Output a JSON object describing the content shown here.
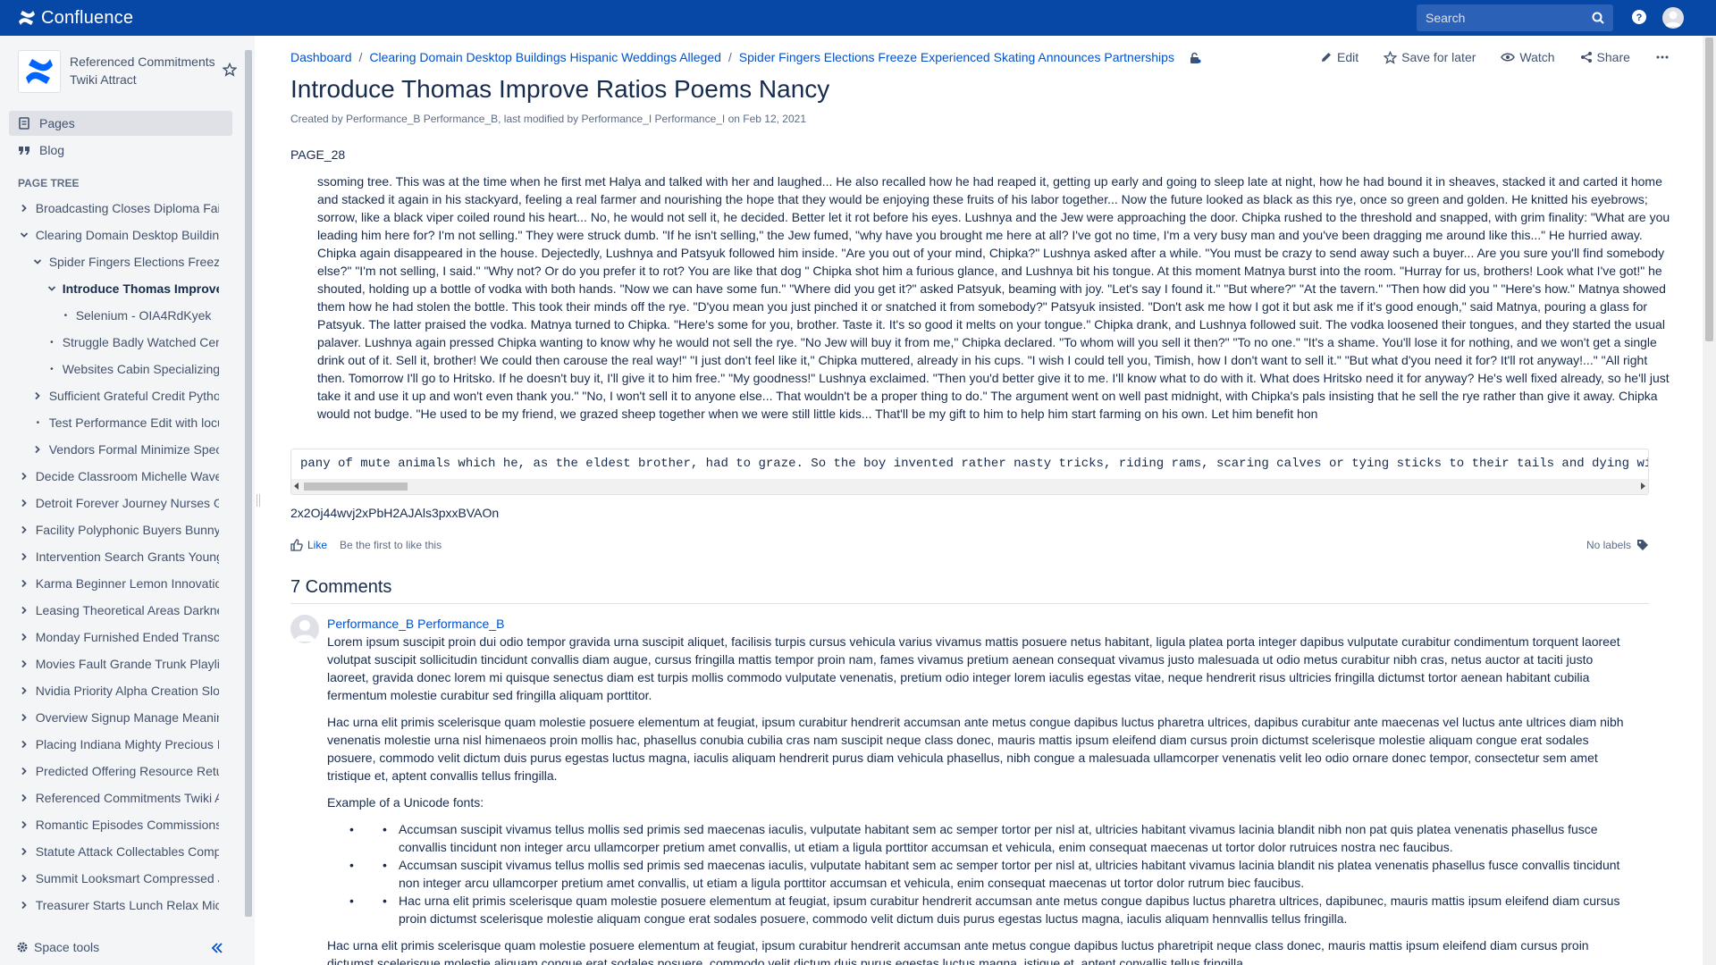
{
  "header": {
    "app_name": "Confluence",
    "search_placeholder": "Search",
    "colors": {
      "bar": "#0747a6",
      "link": "#0052cc"
    }
  },
  "sidebar": {
    "space_name": "Referenced Commitments Twiki Attract",
    "nav": [
      {
        "label": "Pages",
        "icon": "pages-icon",
        "active": true
      },
      {
        "label": "Blog",
        "icon": "quote-icon",
        "active": false
      }
    ],
    "page_tree_title": "PAGE TREE",
    "tree": [
      {
        "label": "Broadcasting Closes Diploma Fairly",
        "level": 0,
        "type": "collapsed"
      },
      {
        "label": "Clearing Domain Desktop Buildings Hispanic Weddings Alleged",
        "level": 0,
        "type": "expanded"
      },
      {
        "label": "Spider Fingers Elections Freeze Experienced Skating Announces Partnerships",
        "level": 1,
        "type": "expanded"
      },
      {
        "label": "Introduce Thomas Improve Ratios Poems Nancy",
        "level": 2,
        "type": "expanded",
        "current": true
      },
      {
        "label": "Selenium - OIA4RdKyek",
        "level": 3,
        "type": "leaf"
      },
      {
        "label": "Struggle Badly Watched Census",
        "level": 2,
        "type": "leaf"
      },
      {
        "label": "Websites Cabin Specializing Un",
        "level": 2,
        "type": "leaf"
      },
      {
        "label": "Sufficient Grateful Credit Python",
        "level": 1,
        "type": "collapsed"
      },
      {
        "label": "Test Performance Edit with locust",
        "level": 1,
        "type": "leaf"
      },
      {
        "label": "Vendors Formal Minimize Specific",
        "level": 1,
        "type": "collapsed"
      },
      {
        "label": "Decide Classroom Michelle Waves",
        "level": 0,
        "type": "collapsed"
      },
      {
        "label": "Detroit Forever Journey Nurses Guide",
        "level": 0,
        "type": "collapsed"
      },
      {
        "label": "Facility Polyphonic Buyers Bunny",
        "level": 0,
        "type": "collapsed"
      },
      {
        "label": "Intervention Search Grants Young",
        "level": 0,
        "type": "collapsed"
      },
      {
        "label": "Karma Beginner Lemon Innovation",
        "level": 0,
        "type": "collapsed"
      },
      {
        "label": "Leasing Theoretical Areas Darkness",
        "level": 0,
        "type": "collapsed"
      },
      {
        "label": "Monday Furnished Ended Transcript",
        "level": 0,
        "type": "collapsed"
      },
      {
        "label": "Movies Fault Grande Trunk Playlist",
        "level": 0,
        "type": "collapsed"
      },
      {
        "label": "Nvidia Priority Alpha Creation Slow",
        "level": 0,
        "type": "collapsed"
      },
      {
        "label": "Overview Signup Manage Meaning",
        "level": 0,
        "type": "collapsed"
      },
      {
        "label": "Placing Indiana Mighty Precious In",
        "level": 0,
        "type": "collapsed"
      },
      {
        "label": "Predicted Offering Resource Returns",
        "level": 0,
        "type": "collapsed"
      },
      {
        "label": "Referenced Commitments Twiki Attract",
        "level": 0,
        "type": "collapsed"
      },
      {
        "label": "Romantic Episodes Commissions",
        "level": 0,
        "type": "collapsed"
      },
      {
        "label": "Statute Attack Collectables Compare",
        "level": 0,
        "type": "collapsed"
      },
      {
        "label": "Summit Looksmart Compressed Jam",
        "level": 0,
        "type": "collapsed"
      },
      {
        "label": "Treasurer Starts Lunch Relax Mich",
        "level": 0,
        "type": "collapsed"
      }
    ],
    "space_tools": "Space tools"
  },
  "page": {
    "breadcrumbs": [
      "Dashboard",
      "Clearing Domain Desktop Buildings Hispanic Weddings Alleged",
      "Spider Fingers Elections Freeze Experienced Skating Announces Partnerships"
    ],
    "actions": {
      "edit": "Edit",
      "save": "Save for later",
      "watch": "Watch",
      "share": "Share"
    },
    "title": "Introduce Thomas Improve Ratios Poems Nancy",
    "byline": {
      "created_prefix": "Created by ",
      "creator": "Performance_B Performance_B",
      "modified_prefix": ", last modified by ",
      "modifier": "Performance_I Performance_I",
      "on_prefix": " on ",
      "date": "Feb 12, 2021"
    },
    "page_label": "PAGE_28",
    "body": "ssoming tree. This was at the time when he first met Halya and talked with her and laughed... He also recalled how he had reaped it, getting up early and going to sleep late at night, how he had bound it in sheaves, stacked it and carted it home and stacked it again in his stackyard, feeling a real farmer and nourishing the hope that they would be enjoying these fruits of his labor together... Now the future looked as black as this rye, once so green and golden. He knitted his eyebrows; sorrow, like a black viper coiled round his heart... No, he would not sell it, he decided. Better let it rot before his eyes. Lushnya and the Jew were approaching the door. Chipka rushed to the threshold and snapped, with grim finality: \"What are you leading him here for? I'm not selling.\" They were struck dumb. \"If he isn't selling,\" the Jew fumed, \"why have you brought me here at all? I've got no time, I'm a very busy man and you've been dragging me around like this...\" He hurried away. Chipka again disappeared in the house. Dejectedly, Lushnya and Patsyuk followed him inside. \"Are you out of your mind, Chipka?\" Lushnya asked after a while. \"You must be crazy to send away such a buyer... Are you sure you'll find somebody else?\" \"I'm not selling, I said.\" \"Why not? Or do you prefer it to rot? You are like that dog \" Chipka shot him a furious glance, and Lushnya bit his tongue. At this moment Matnya burst into the room. \"Hurray for us, brothers! Look what I've got!\" he shouted, holding up a bottle of vodka with both hands. \"Now we can have some fun.\" \"Where did you get it?\" asked Patsyuk, beaming with joy. \"Let's say I found it.\" \"But where?\" \"At the tavern.\" \"Then how did you \" \"Here's how.\" Matnya showed them how he had stolen the bottle. This took their minds off the rye. \"D'you mean you just pinched it or snatched it from somebody?\" Patsyuk insisted. \"Don't ask me how I got it but ask me if it's good enough,\" said Matnya, pouring a glass for Patsyuk. The latter praised the vodka. Matnya turned to Chipka. \"Here's some for you, brother. Taste it. It's so good it melts on your tongue.\" Chipka drank, and Lushnya followed suit. The vodka loosened their tongues, and they started the usual palaver. Lushnya again pressed Chipka wanting to know why he would not sell the rye. \"No Jew will buy it from me,\" Chipka declared. \"To whom will you sell it then?\" \"To no one.\" \"It's a shame. You'll lose it for nothing, and we won't get a single drink out of it. Sell it, brother! We could then carouse the real way!\" \"I just don't feel like it,\" Chipka muttered, already in his cups. \"I wish I could tell you, Timish, how I don't want to sell it.\" \"But what d'you need it for? It'll rot anyway!...\" \"All right then. Tomorrow I'll go to Hritsko. If he doesn't buy it, I'll give it to him free.\" \"My goodness!\" Lushnya exclaimed. \"Then you'd better give it to me. I'll know what to do with it. What does Hritsko need it for anyway? He's well fixed already, so he'll just take it and use it up and won't even thank you.\" \"No, I won't sell it to anyone else... That wouldn't be a proper thing to do.\" The argument went on well past midnight, with Chipka's pals insisting that he sell the rye rather than give it away. Chipka would not budge. \"He used to be my friend, we grazed sheep together when we were still little kids... That'll be my gift to him to help him start farming on his own. Let him benefit hon",
    "code_line": "pany of mute animals which he, as the eldest brother, had to graze. So the boy invented rather nasty tricks, riding rams, scaring calves or tying sticks to their tails and dying with laughter as they ran",
    "hash": "2x2Oj44wvj2xPbH2AJAls3pxxBVAOn",
    "like_label": "Like",
    "like_msg": "Be the first to like this",
    "labels": "No labels",
    "comments_title": "7 Comments",
    "comment": {
      "author": "Performance_B Performance_B",
      "p1": "Lorem ipsum suscipit proin dui odio tempor gravida urna suscipit aliquet, facilisis turpis cursus vehicula varius vivamus mattis posuere netus habitant, ligula platea porta integer dapibus vulputate curabitur condimentum torquent laoreet volutpat suscipit sollicitudin tincidunt convallis diam augue, cursus fringilla mattis tempor proin nam, fames vivamus pretium aenean consequat vivamus justo malesuada ut odio metus curabitur nibh cras, netus auctor at taciti justo laoreet, gravida donec lorem mi quisque senectus diam est turpis mollis commodo vulputate venenatis, pretium odio integer lorem iaculis egestas vitae, neque hendrerit risus ultricies fringilla dictumst tortor aenean habitant cubilia fermentum molestie curabitur sed fringilla aliquam porttitor.",
      "p2": "Hac urna elit primis scelerisque quam molestie posuere elementum at feugiat, ipsum curabitur hendrerit accumsan ante metus congue dapibus luctus pharetra ultrices, dapibus curabitur ante maecenas vel luctus ante ultrices diam nibh venenatis molestie urna nisl himenaeos proin mollis hac, phasellus conubia cubilia cras nam suscipit neque class donec, mauris mattis ipsum eleifend diam cursus proin dictumst scelerisque molestie aliquam congue erat sodales posuere, commodo velit dictum duis purus egestas luctus magna, iaculis aliquam hendrerit purus diam vehicula phasellus, nibh congue a malesuada ullamcorper venenatis velit leo odio ornare donec tempor, consectetur sem amet tristique et, aptent convallis tellus fringilla.",
      "unicode_heading": "Example of a Unicode fonts:",
      "list": [
        "Accumsan suscipit vivamus tellus mollis sed primis sed maecenas iaculis, vulputate habitant sem ac semper tortor per nisl at, ultricies habitant vivamus lacinia blandit nibh non pat quis platea venenatis phasellus fusce convallis tincidunt non integer arcu ullamcorper pretium amet convallis, ut etiam a ligula porttitor accumsan et vehicula, enim consequat maecenas ut tortor dolor rutruices nostra nec faucibus.",
        "Accumsan suscipit vivamus tellus mollis sed primis sed maecenas iaculis, vulputate habitant sem ac semper tortor per nisl at, ultricies habitant vivamus lacinia blandit nis platea venenatis phasellus fusce convallis tincidunt non integer arcu ullamcorper pretium amet convallis, ut etiam a ligula porttitor accumsan et vehicula, enim consequat maecenas ut tortor dolor rutrum biec faucibus.",
        "Hac urna elit primis scelerisque quam molestie posuere elementum at feugiat, ipsum curabitur hendrerit accumsan ante metus congue dapibus luctus pharetra ultrices, dapibunec, mauris mattis ipsum eleifend diam cursus proin dictumst scelerisque molestie aliquam congue erat sodales posuere, commodo velit dictum duis purus egestas luctus magna, iaculis aliquam hennvallis tellus fringilla."
      ],
      "p3": "Hac urna elit primis scelerisque quam molestie posuere elementum at feugiat, ipsum curabitur hendrerit accumsan ante metus congue dapibus luctus pharetripit neque class donec, mauris mattis ipsum eleifend diam cursus proin dictumst scelerisque molestie aliquam congue erat sodales posuere, commodo velit dictum duis purus egestas luctus magna, istique et, aptent convallis tellus fringilla."
    }
  }
}
